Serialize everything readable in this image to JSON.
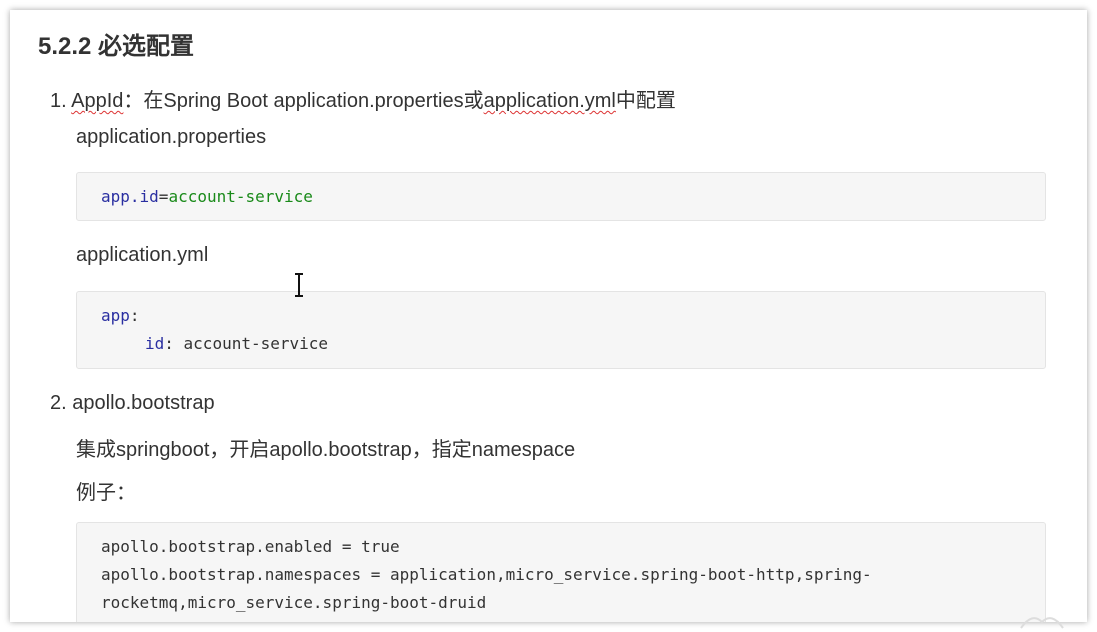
{
  "heading": "5.2.2 必选配置",
  "item1": {
    "number": "1.",
    "term": "AppId",
    "text_a": "：在Spring Boot application.properties或",
    "term2": "application.yml",
    "text_b": "中配置"
  },
  "props_label": "application.properties",
  "code1": {
    "key": "app.id",
    "eq": "=",
    "value": "account-service"
  },
  "yml_label": "application.yml",
  "code2": {
    "line1_key": "app",
    "line1_colon": ":",
    "line2_key": "id",
    "line2_colon": ":",
    "line2_value": " account-service"
  },
  "item2": {
    "number": "2.",
    "text": "apollo.bootstrap"
  },
  "item2_desc": "集成springboot，开启apollo.bootstrap，指定namespace",
  "example_label": "例子：",
  "code3": {
    "line1": "apollo.bootstrap.enabled = true",
    "line2": "apollo.bootstrap.namespaces = application,micro_service.spring-boot-http,spring-",
    "line3": "rocketmq,micro_service.spring-boot-druid"
  },
  "colors": {
    "code_key": "#2a2fa1",
    "code_value": "#1a8a1a",
    "squiggle": "#dd3333"
  },
  "icons": {
    "cursor": "text-cursor-icon"
  }
}
